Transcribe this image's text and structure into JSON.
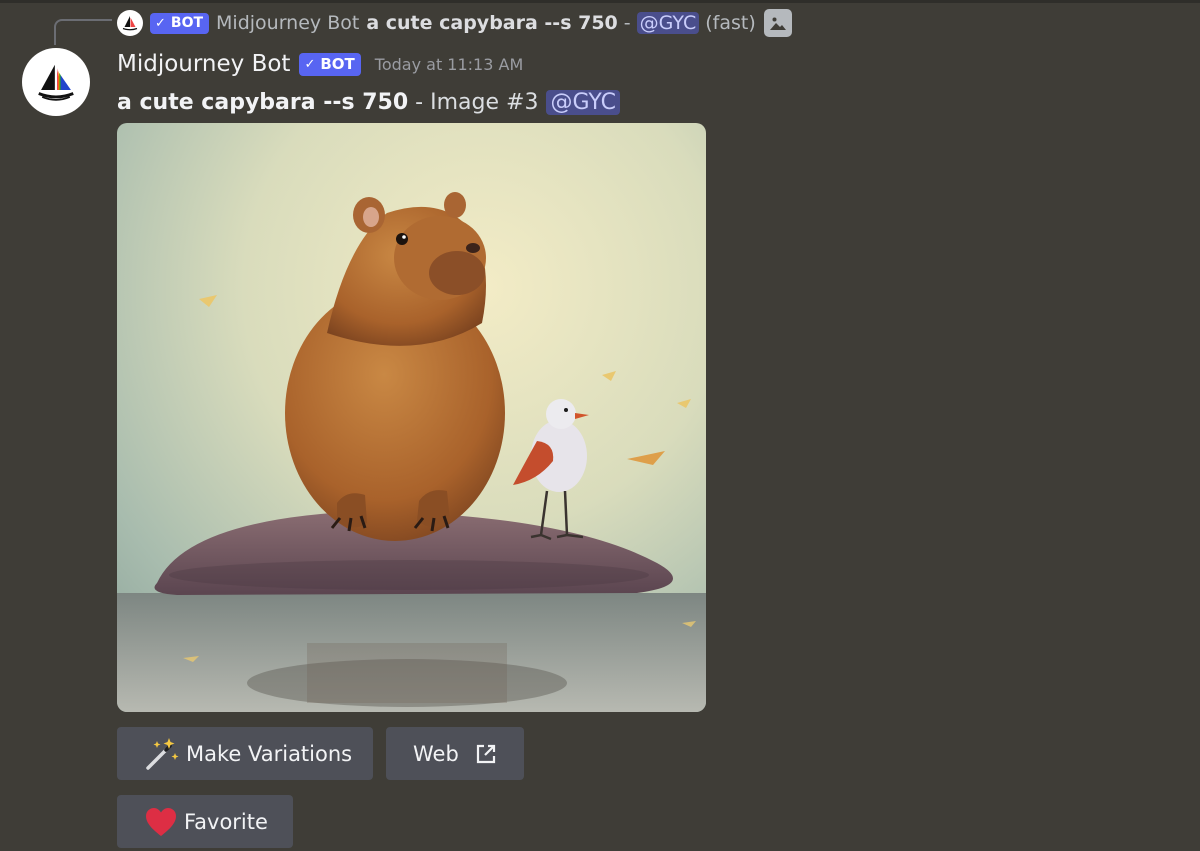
{
  "reply": {
    "bot_badge": "BOT",
    "author": "Midjourney Bot",
    "prompt": "a cute capybara --s 750",
    "dash": "-",
    "mention": "@GYC",
    "mode": "(fast)",
    "icon": "image-icon"
  },
  "message": {
    "author": "Midjourney Bot",
    "bot_badge": "BOT",
    "timestamp": "Today at 11:13 AM",
    "prompt": "a cute capybara --s 750",
    "dash": "-",
    "image_label": "Image #3",
    "mention": "@GYC",
    "attachment": "capybara-with-bird-image"
  },
  "buttons": {
    "variations": {
      "label": "Make Variations",
      "icon": "magic-wand-icon"
    },
    "web": {
      "label": "Web",
      "icon": "external-link-icon"
    },
    "favorite": {
      "label": "Favorite",
      "icon": "heart-icon"
    }
  },
  "colors": {
    "background": "#3f3d37",
    "bot_badge": "#5865f2",
    "mention_bg": "#4a4e8c",
    "button_bg": "#4e5058"
  }
}
